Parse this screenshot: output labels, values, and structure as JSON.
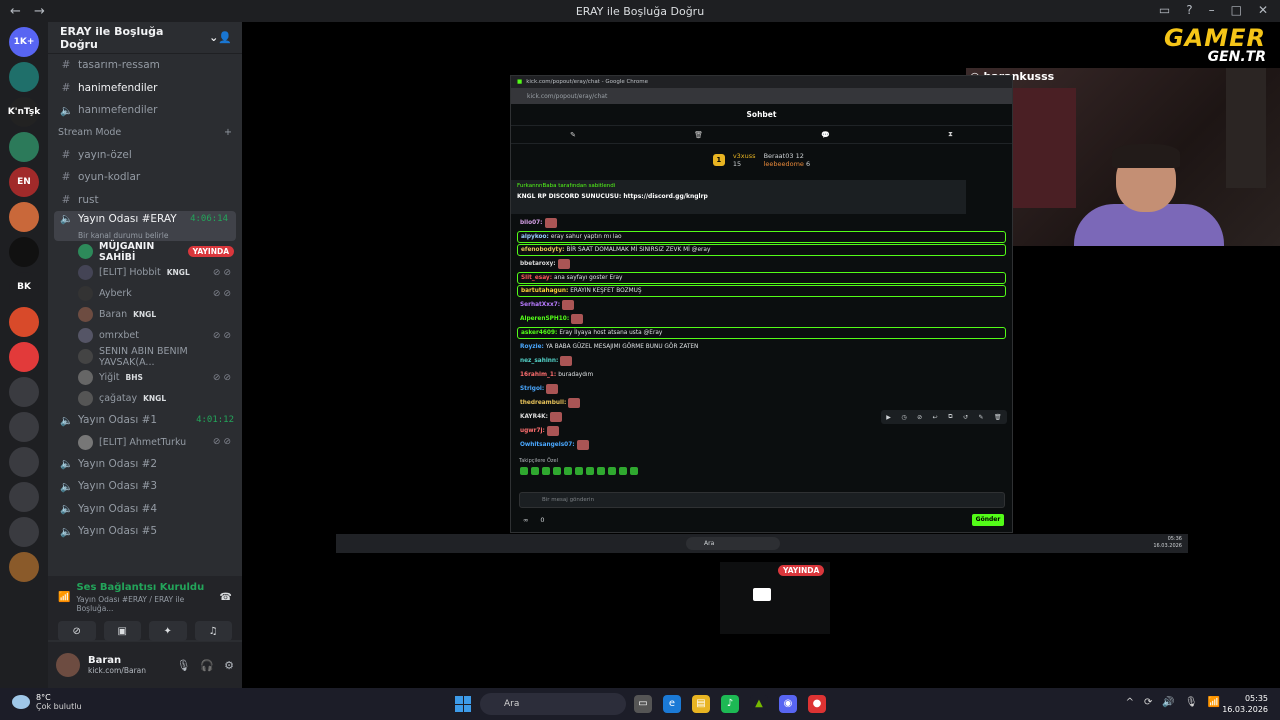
{
  "window": {
    "title": "ERAY ile Boşluğa Doğru",
    "back_icon": "arrow-left-icon",
    "forward_icon": "arrow-right-icon"
  },
  "servers": {
    "items": [
      "1K+",
      "",
      "K'nTşk",
      "",
      "EN",
      "",
      "",
      "BK",
      "",
      "",
      "",
      "",
      "",
      "",
      "",
      ""
    ]
  },
  "guild": {
    "name": "ERAY ile Boşluğa Doğru"
  },
  "channels": {
    "top": [
      {
        "name": "tasarım-ressam"
      },
      {
        "name": "hanimefendiler"
      },
      {
        "name": "hanımefendiler"
      }
    ],
    "stream_category": "Stream Mode",
    "stream": [
      {
        "name": "yayın-özel"
      },
      {
        "name": "oyun-kodlar"
      },
      {
        "name": "rust"
      }
    ],
    "voice_main": {
      "name": "Yayın Odası #ERAY",
      "timer": "4:06:14",
      "status": "Bir kanal durumu belirle"
    },
    "voice_users": [
      {
        "name": "MÜJGANIN SAHİBİ",
        "tag": "",
        "live": "YAYINDA"
      },
      {
        "name": "[ELIT] Hobbit",
        "tag": "KNGL",
        "live": ""
      },
      {
        "name": "Ayberk",
        "tag": "",
        "live": ""
      },
      {
        "name": "Baran",
        "tag": "KNGL",
        "live": ""
      },
      {
        "name": "omrxbet",
        "tag": "",
        "live": ""
      },
      {
        "name": "SENIN ABIN BENIM YAVSAK(A...",
        "tag": "",
        "live": ""
      },
      {
        "name": "Yiğit",
        "tag": "BHS",
        "live": ""
      },
      {
        "name": "çağatay",
        "tag": "KNGL",
        "live": ""
      }
    ],
    "voice_room1": {
      "name": "Yayın Odası #1",
      "timer": "4:01:12"
    },
    "voice_room1_users": [
      {
        "name": "[ELIT] AhmetTurku"
      }
    ],
    "voice_rooms": [
      {
        "name": "Yayın Odası #2"
      },
      {
        "name": "Yayın Odası #3"
      },
      {
        "name": "Yayın Odası #4"
      },
      {
        "name": "Yayın Odası #5"
      }
    ]
  },
  "voice_panel": {
    "status": "Ses Bağlantısı Kuruldu",
    "sub": "Yayın Odası #ERAY / ERAY ile Boşluğa..."
  },
  "user_panel": {
    "name": "Baran",
    "sub": "kick.com/Baran"
  },
  "brand": {
    "line1": "GAMER",
    "line2": "GEN.TR"
  },
  "webcam": {
    "handle": "barankusss"
  },
  "kick": {
    "tab_title": "kick.com/popout/eray/chat - Google Chrome",
    "url": "kick.com/popout/eray/chat",
    "header": "Sohbet",
    "gifters": [
      {
        "name": "v3xuss",
        "count": "15"
      },
      {
        "name": "Beraat03",
        "count": "12"
      },
      {
        "name": "leebeedome",
        "count": "6"
      }
    ],
    "pinned_by": "FurkannnBaba tarafından sabitlendi",
    "pinned_text": "KNGL RP DISCORD SUNUCUSU: https://discord.gg/knglrp",
    "messages": [
      {
        "user": "bilo07:",
        "text": "",
        "color": "#d7a1e8",
        "boxed": false,
        "emote": true
      },
      {
        "user": "alpykoo:",
        "text": "eray sahur yaptın mı lao",
        "color": "#9ad0ff",
        "boxed": true,
        "emote": false
      },
      {
        "user": "efenobodyty:",
        "text": "BİR SAAT DOMALMAK Mİ SINIRSIZ ZEVK Mİ @eray",
        "color": "#e8c35a",
        "boxed": true,
        "emote": false
      },
      {
        "user": "bbetaroxy:",
        "text": "",
        "color": "#dcdcdc",
        "boxed": false,
        "emote": true
      },
      {
        "user": "Slit_esay:",
        "text": "ana sayfayı goster Eray",
        "color": "#ff5a5a",
        "boxed": true,
        "emote": false
      },
      {
        "user": "bartutahagun:",
        "text": "ERAYIN KEŞFET BOZMUŞ",
        "color": "#ffcf3d",
        "boxed": true,
        "emote": false
      },
      {
        "user": "SerhatXxx7:",
        "text": "",
        "color": "#b97cff",
        "boxed": false,
        "emote": true
      },
      {
        "user": "AlperenSPH10:",
        "text": "",
        "color": "#53fc18",
        "boxed": false,
        "emote": true
      },
      {
        "user": "asker4609:",
        "text": "Eray İlyaya host atsana usta @Eray",
        "color": "#53fc18",
        "boxed": true,
        "emote": false
      },
      {
        "user": "Royzie:",
        "text": "YA BABA GÜZEL MESAJIMI GÖRME BUNU GÖR ZATEN",
        "color": "#4aa8ff",
        "boxed": false,
        "emote": false
      },
      {
        "user": "nez_sahinn:",
        "text": "",
        "color": "#53d3c9",
        "boxed": false,
        "emote": true
      },
      {
        "user": "16rahim_1:",
        "text": "buradaydım",
        "color": "#ff6f6f",
        "boxed": false,
        "emote": false
      },
      {
        "user": "Strigoi:",
        "text": "",
        "color": "#4aa8ff",
        "boxed": false,
        "emote": true
      },
      {
        "user": "thedreambull:",
        "text": "",
        "color": "#e8c35a",
        "boxed": false,
        "emote": true
      },
      {
        "user": "KAYR4K:",
        "text": "",
        "color": "#dcdcdc",
        "boxed": false,
        "emote": true
      },
      {
        "user": "ugwr7j:",
        "text": "",
        "color": "#ff6f6f",
        "boxed": false,
        "emote": true
      },
      {
        "user": "Owhitsangels07:",
        "text": "",
        "color": "#4aa8ff",
        "boxed": false,
        "emote": true
      }
    ],
    "sub_only": "Takipçilere Özel",
    "input_placeholder": "Bir mesaj gönderin",
    "infinity": "∞",
    "count": "0",
    "send": "Gönder"
  },
  "mini_taskbar": {
    "search": "Ara",
    "time": "05:36",
    "date": "16.03.2026"
  },
  "preview": {
    "live": "YAYINDA"
  },
  "taskbar": {
    "temp": "8°C",
    "weather": "Çok bulutlu",
    "search": "Ara",
    "time": "05:35",
    "date": "16.03.2026"
  },
  "colors": {
    "discord_green": "#23a55a",
    "kick_green": "#53fc18",
    "live_red": "#da373c",
    "brand_yellow": "#f5c518"
  }
}
